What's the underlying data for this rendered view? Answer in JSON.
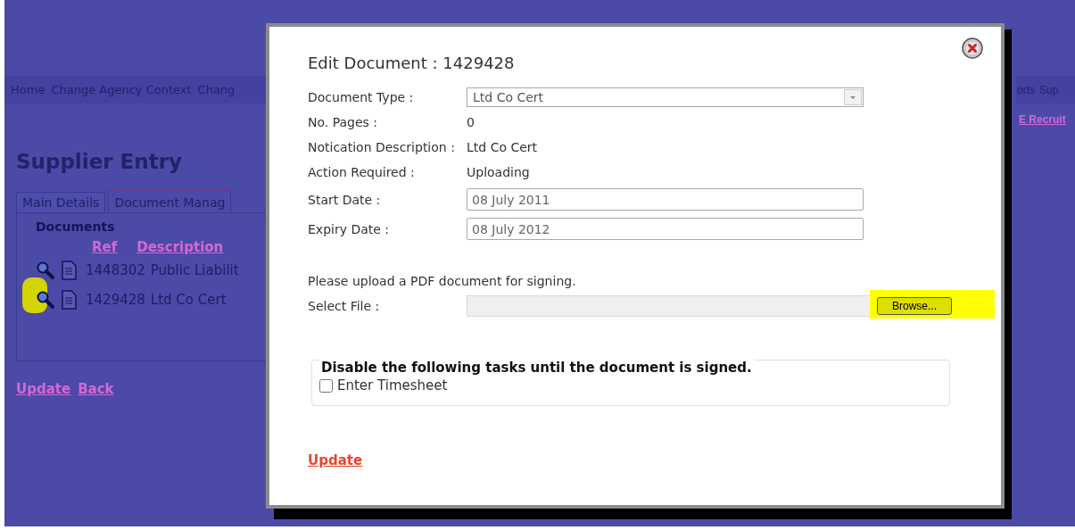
{
  "nav": {
    "left": [
      "Home",
      "Change Agency Context",
      "Chang"
    ],
    "right": [
      "orts",
      "Sup"
    ]
  },
  "top_link": "E Recruit",
  "heading": "Supplier Entry",
  "tabs": [
    {
      "label": "Main Details",
      "selected": false
    },
    {
      "label": "Document Manag",
      "selected": true
    }
  ],
  "documents": {
    "legend": "Documents",
    "columns": [
      "Ref",
      "Description"
    ],
    "rows": [
      {
        "ref": "1448302",
        "description": "Public Liabilit",
        "highlighted": false
      },
      {
        "ref": "1429428",
        "description": "Ltd Co Cert",
        "highlighted": true
      }
    ]
  },
  "links": [
    "Update",
    "Back"
  ],
  "dialog": {
    "title": "Edit Document : 1429428",
    "fields": [
      {
        "kind": "select",
        "label": "Document Type :",
        "value": "Ltd Co Cert"
      },
      {
        "kind": "text",
        "label": "No. Pages :",
        "value": "0"
      },
      {
        "kind": "text",
        "label": "Notication Description :",
        "value": "Ltd Co Cert"
      },
      {
        "kind": "text",
        "label": "Action Required :",
        "value": "Uploading"
      },
      {
        "kind": "input",
        "label": "Start Date :",
        "value": "08 July 2011"
      },
      {
        "kind": "input",
        "label": "Expiry Date :",
        "value": "08 July 2012"
      }
    ],
    "upload_note": "Please upload a PDF document for signing.",
    "file": {
      "label": "Select File :",
      "button": "Browse...",
      "highlighted": true
    },
    "tasks": {
      "legend": "Disable the following tasks until the document is signed.",
      "items": [
        {
          "label": "Enter Timesheet",
          "checked": false
        }
      ]
    },
    "update": "Update"
  }
}
